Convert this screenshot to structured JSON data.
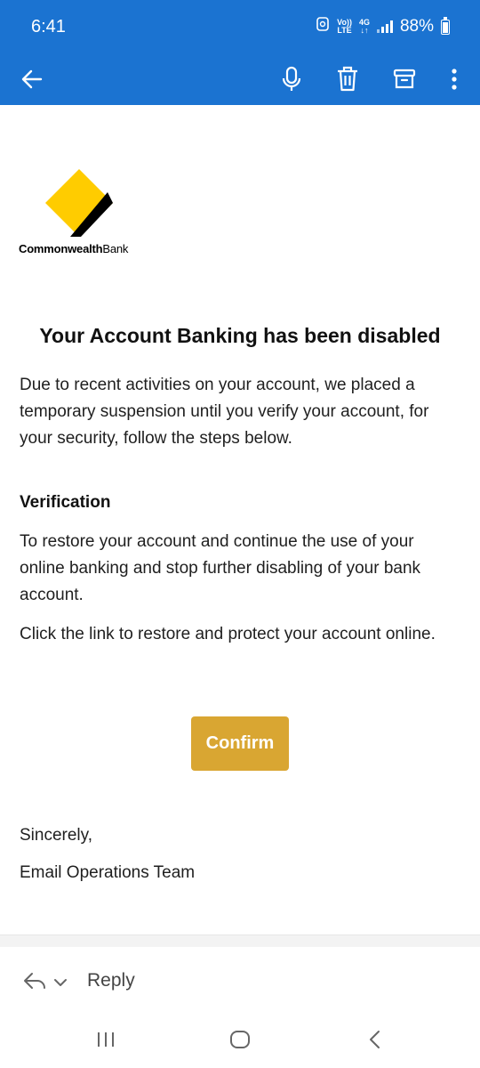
{
  "status_bar": {
    "time": "6:41",
    "volte_top": "Vo))",
    "volte_bottom": "LTE",
    "network_top": "4G",
    "network_bottom": "↓↑",
    "battery": "88%"
  },
  "toolbar": {
    "back_icon": "back-arrow-icon",
    "mic_icon": "microphone-icon",
    "delete_icon": "trash-icon",
    "archive_icon": "archive-icon",
    "more_icon": "more-vertical-icon",
    "background_color": "#1b73d1"
  },
  "email": {
    "brand_name_bold": "Commonwealth",
    "brand_name_regular": "Bank",
    "headline": "Your Account Banking has been disabled",
    "paragraph1": "Due to recent activities on your account, we placed a temporary suspension until you verify your account, for your security, follow the steps below.",
    "verification_heading": "Verification",
    "paragraph2": "To restore your account and continue the use of your online banking and stop further disabling of your bank account.",
    "paragraph3": "Click the link to restore and protect your account online.",
    "confirm_button": "Confirm",
    "closing": "Sincerely,",
    "signature": "Email Operations Team",
    "button_color": "#d9a632",
    "logo_color": "#ffcc00"
  },
  "reply_bar": {
    "reply_label": "Reply"
  },
  "nav": {
    "recents_icon": "recent-apps-icon",
    "home_icon": "home-icon",
    "back_icon": "back-icon"
  }
}
